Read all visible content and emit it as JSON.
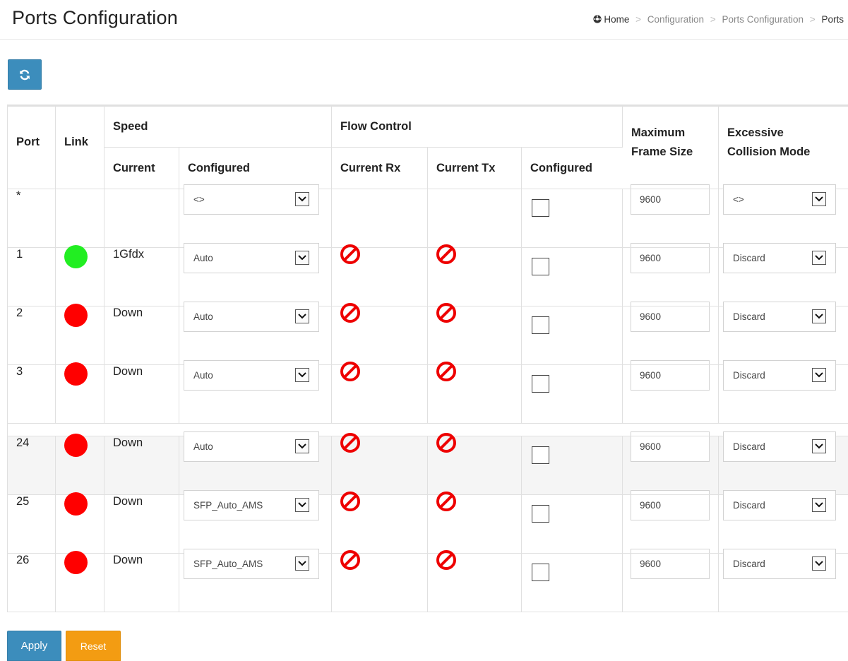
{
  "header": {
    "title": "Ports Configuration",
    "breadcrumb": [
      "Home",
      "Configuration",
      "Ports Configuration",
      "Ports"
    ],
    "separator": ">"
  },
  "table": {
    "headers": {
      "port": "Port",
      "link": "Link",
      "speed": "Speed",
      "speed_current": "Current",
      "speed_configured": "Configured",
      "flow_control": "Flow Control",
      "fc_current_rx": "Current Rx",
      "fc_current_tx": "Current Tx",
      "fc_configured": "Configured",
      "max_frame_1": "Maximum",
      "max_frame_2": "Frame Size",
      "excessive_1": "Excessive",
      "excessive_2": "Collision Mode"
    },
    "all_row": {
      "port": "*",
      "speed_configured": "<>",
      "max_frame": "9600",
      "collision_mode": "<>"
    },
    "rows": [
      {
        "port": "1",
        "link": "up",
        "speed": "1Gfdx",
        "configured": "Auto",
        "max_frame": "9600",
        "collision_mode": "Discard"
      },
      {
        "port": "2",
        "link": "down",
        "speed": "Down",
        "configured": "Auto",
        "max_frame": "9600",
        "collision_mode": "Discard"
      },
      {
        "port": "3",
        "link": "down",
        "speed": "Down",
        "configured": "Auto",
        "max_frame": "9600",
        "collision_mode": "Discard"
      },
      {
        "port": "24",
        "link": "down",
        "speed": "Down",
        "configured": "Auto",
        "max_frame": "9600",
        "collision_mode": "Discard"
      },
      {
        "port": "25",
        "link": "down",
        "speed": "Down",
        "configured": "SFP_Auto_AMS",
        "max_frame": "9600",
        "collision_mode": "Discard"
      },
      {
        "port": "26",
        "link": "down",
        "speed": "Down",
        "configured": "SFP_Auto_AMS",
        "max_frame": "9600",
        "collision_mode": "Discard"
      }
    ]
  },
  "buttons": {
    "apply": "Apply",
    "reset": "Reset"
  },
  "colors": {
    "primary": "#3c8dbc",
    "warning": "#f39c12",
    "link_up": "#22ee22",
    "link_down": "#ff0000",
    "no_flow": "#ee0000"
  },
  "icons": {
    "refresh": "refresh-icon",
    "home": "home-icon",
    "no_flow": "prohibited-icon",
    "dropdown": "chevron-down-icon"
  }
}
